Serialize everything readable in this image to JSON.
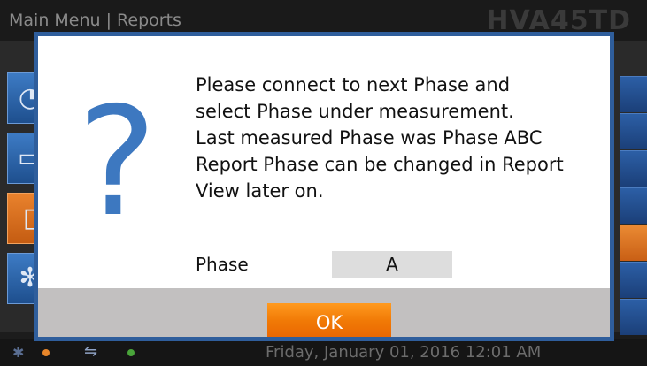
{
  "app": {
    "breadcrumb": "Main Menu  |  Reports",
    "model": "HVA45TD",
    "status": {
      "bluetooth_icon": "bluetooth-icon",
      "usb_icon": "usb-icon",
      "bt_dot_color": "#e8862a",
      "usb_dot_color": "#49a43a",
      "datetime": "Friday, January 01, 2016 12:01 AM"
    }
  },
  "dialog": {
    "icon": "question-mark-icon",
    "message_lines": [
      "Please connect to next Phase and",
      "select Phase under measurement.",
      "Last measured Phase was Phase ABC",
      "Report Phase can be changed in Report",
      "View later on."
    ],
    "phase_label": "Phase",
    "phase_value": "A",
    "ok_label": "OK"
  },
  "colors": {
    "dialog_border": "#2f5e9c",
    "question_icon": "#3d78c0",
    "ok_button": "#f17a06",
    "button_strip": "#c2c0c0"
  }
}
